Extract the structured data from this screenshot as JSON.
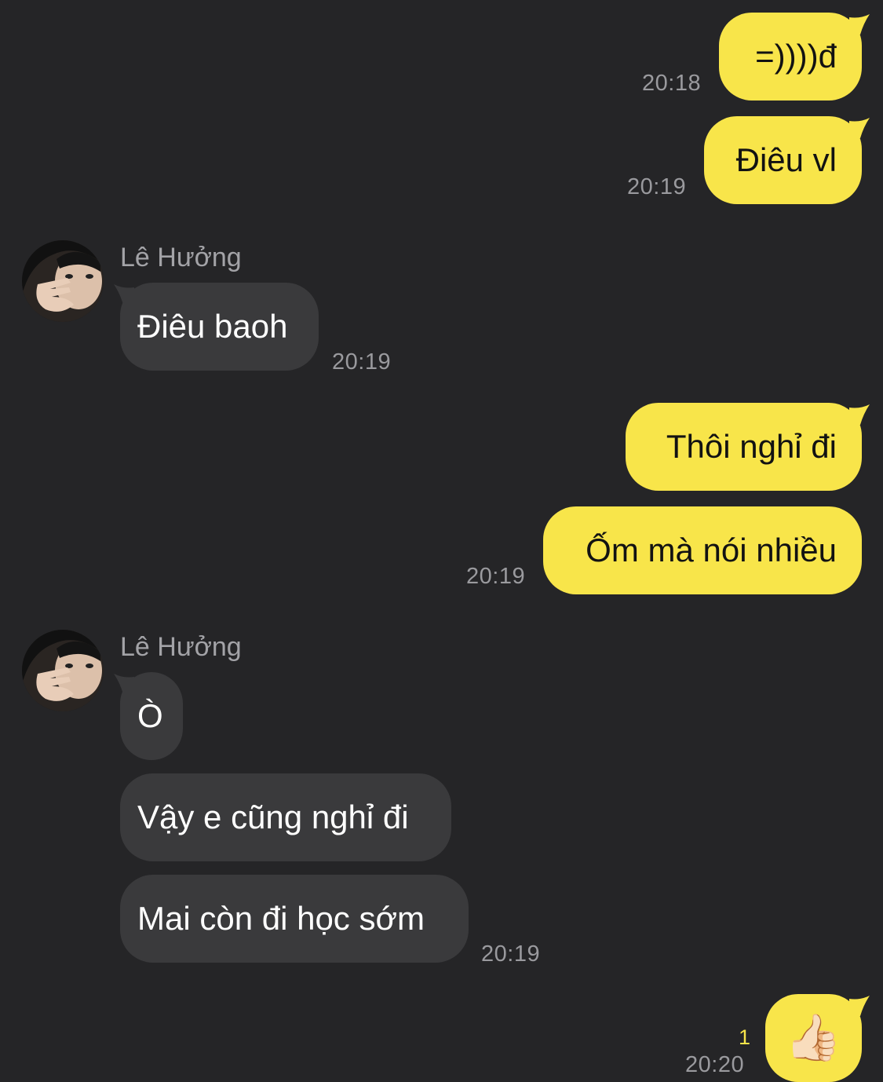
{
  "conversation": {
    "messages": [
      {
        "side": "mine",
        "text": "=))))đ"
      },
      {
        "side": "mine",
        "text": "Điêu vl"
      },
      {
        "side": "theirs",
        "text": "Điêu baoh"
      },
      {
        "side": "mine",
        "text": "Thôi nghỉ đi"
      },
      {
        "side": "mine",
        "text": "Ốm mà nói nhiều"
      },
      {
        "side": "theirs",
        "text": "Ò"
      },
      {
        "side": "theirs",
        "text": "Vậy e cũng nghỉ đi"
      },
      {
        "side": "theirs",
        "text": "Mai còn đi học sớm"
      },
      {
        "side": "mine",
        "text": "👍🏻",
        "icon": "thumbs-up-icon",
        "unread_count": "1"
      }
    ],
    "timestamps": [
      "20:18",
      "20:19",
      "20:19",
      "20:19",
      "20:19",
      "20:20"
    ],
    "sender": {
      "name": "Lê Hưởng",
      "avatar": "avatar-photo"
    }
  },
  "colors": {
    "background": "#252527",
    "my_bubble": "#F8E54A",
    "their_bubble": "#3A3A3C",
    "timestamp": "#9A9A9E",
    "sender_name": "#A3A3A7",
    "read_count": "#F8E54A"
  }
}
